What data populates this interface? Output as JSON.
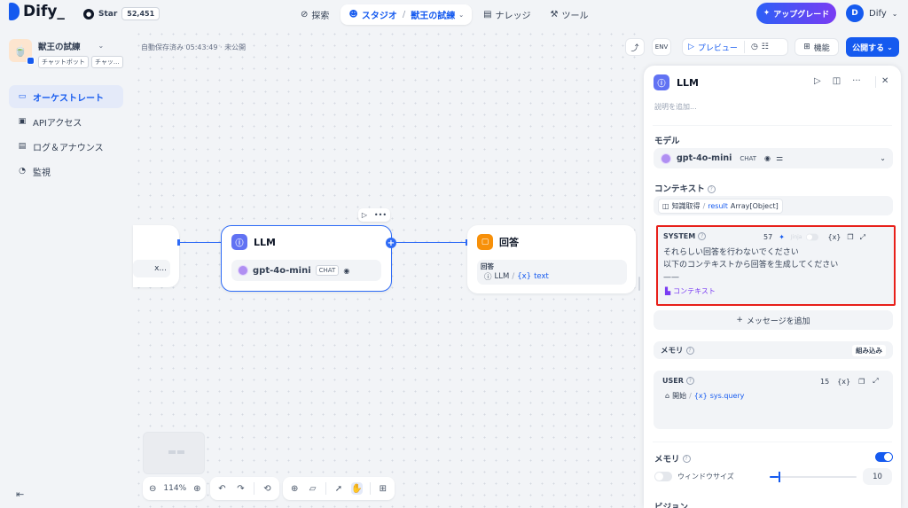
{
  "topbar": {
    "logo_text": "Dify_",
    "github_label": "Star",
    "github_count": "52,451",
    "nav": {
      "explore": "探索",
      "studio": "スタジオ",
      "app_name": "獣王の試練",
      "knowledge": "ナレッジ",
      "tools": "ツール"
    },
    "upgrade_label": "アップグレード",
    "user_initial": "D",
    "user_name": "Dify"
  },
  "sidebar": {
    "app_name": "獣王の試練",
    "tags": [
      "チャットボット",
      "チャッ..."
    ],
    "items": [
      {
        "label": "オーケストレート",
        "icon": "layout-icon",
        "active": true
      },
      {
        "label": "APIアクセス",
        "icon": "terminal-icon",
        "active": false
      },
      {
        "label": "ログ＆アナウンス",
        "icon": "document-icon",
        "active": false
      },
      {
        "label": "監視",
        "icon": "gauge-icon",
        "active": false
      }
    ]
  },
  "canvas": {
    "autosave": "自動保存済み 05:43:49 · 未公開",
    "left_node_chip": "x...",
    "llm_node": {
      "title": "LLM",
      "model": "gpt-4o-mini",
      "badge": "CHAT"
    },
    "answer_node": {
      "title": "回答",
      "field_label": "回答",
      "source": "LLM",
      "separator": "/",
      "variable": "text"
    },
    "zoom": "114%"
  },
  "toolbar": {
    "preview": "プレビュー",
    "features": "機能",
    "publish": "公開する"
  },
  "panel": {
    "title": "LLM",
    "description_placeholder": "説明を追加...",
    "model_label": "モデル",
    "model_name": "gpt-4o-mini",
    "model_badge": "CHAT",
    "context_label": "コンテキスト",
    "context_source": "知識取得",
    "context_sep": "/",
    "context_var": "result",
    "context_type": "Array[Object]",
    "system": {
      "label": "SYSTEM",
      "count": "57",
      "jinja": "Jinja",
      "var_icon": "{x}",
      "lines": [
        "それらしい回答を行わないでください",
        "以下のコンテキストから回答を生成してください",
        "——"
      ],
      "context_chip": "コンテキスト"
    },
    "add_message": "メッセージを追加",
    "memory_row_label": "メモリ",
    "memory_builtin": "組み込み",
    "user": {
      "label": "USER",
      "count": "15",
      "var_icon": "{x}",
      "source": "開始",
      "sep": "/",
      "variable": "sys.query"
    },
    "memory_label": "メモリ",
    "memory_enabled": true,
    "window_size_label": "ウィンドウサイズ",
    "window_size_value": "10",
    "window_size_fraction": 0.1,
    "vision_label": "ビジョン"
  },
  "colors": {
    "accent": "#155aef",
    "highlight": "#e8201a",
    "llm_icon": "#6172f3",
    "answer_icon": "#f79009"
  }
}
